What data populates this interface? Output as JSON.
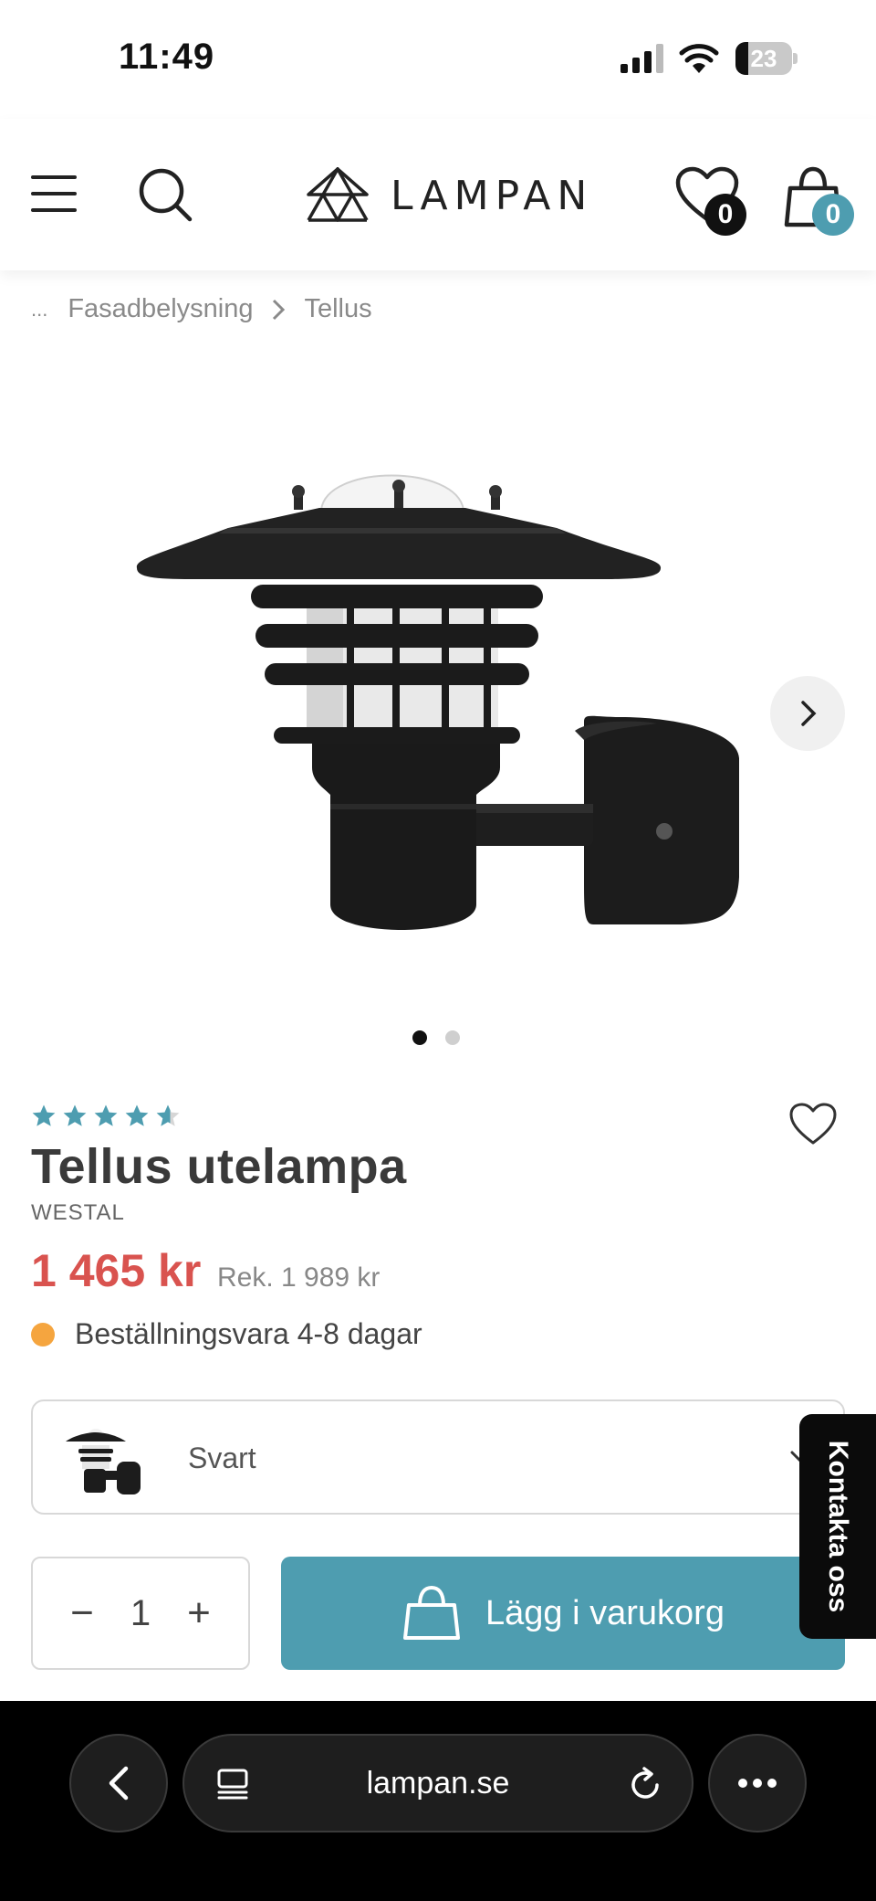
{
  "status_bar": {
    "time": "11:49",
    "battery_percent": "23",
    "battery_level": 0.23
  },
  "header": {
    "logo_text": "LAMPAN",
    "wishlist_count": "0",
    "cart_count": "0",
    "icons": [
      "menu-icon",
      "search-icon",
      "heart-icon",
      "shopping-bag-icon"
    ]
  },
  "breadcrumb": {
    "ellipsis": "...",
    "items": [
      "Fasadbelysning",
      "Tellus"
    ]
  },
  "gallery": {
    "active_index": 0,
    "image_count": 2
  },
  "product": {
    "rating": 4.6,
    "rating_max": 5,
    "title": "Tellus utelampa",
    "brand": "WESTAL",
    "price": "1 465 kr",
    "rek_price": "Rek. 1 989 kr",
    "stock_text": "Beställningsvara 4-8 dagar",
    "variant_label": "Svart",
    "quantity": "1",
    "qty_minus": "−",
    "qty_plus": "+",
    "add_to_cart_label": "Lägg i varukorg",
    "contact_label": "Kontakta oss"
  },
  "browser": {
    "url": "lampan.se"
  },
  "colors": {
    "accent": "#4e9db0",
    "price": "#d9534f",
    "stock_dot": "#f5a53f",
    "star": "#4e9db0",
    "star_empty": "#d6d6d6",
    "dot_active": "#111111",
    "dot_inactive": "#cfcfcf"
  }
}
